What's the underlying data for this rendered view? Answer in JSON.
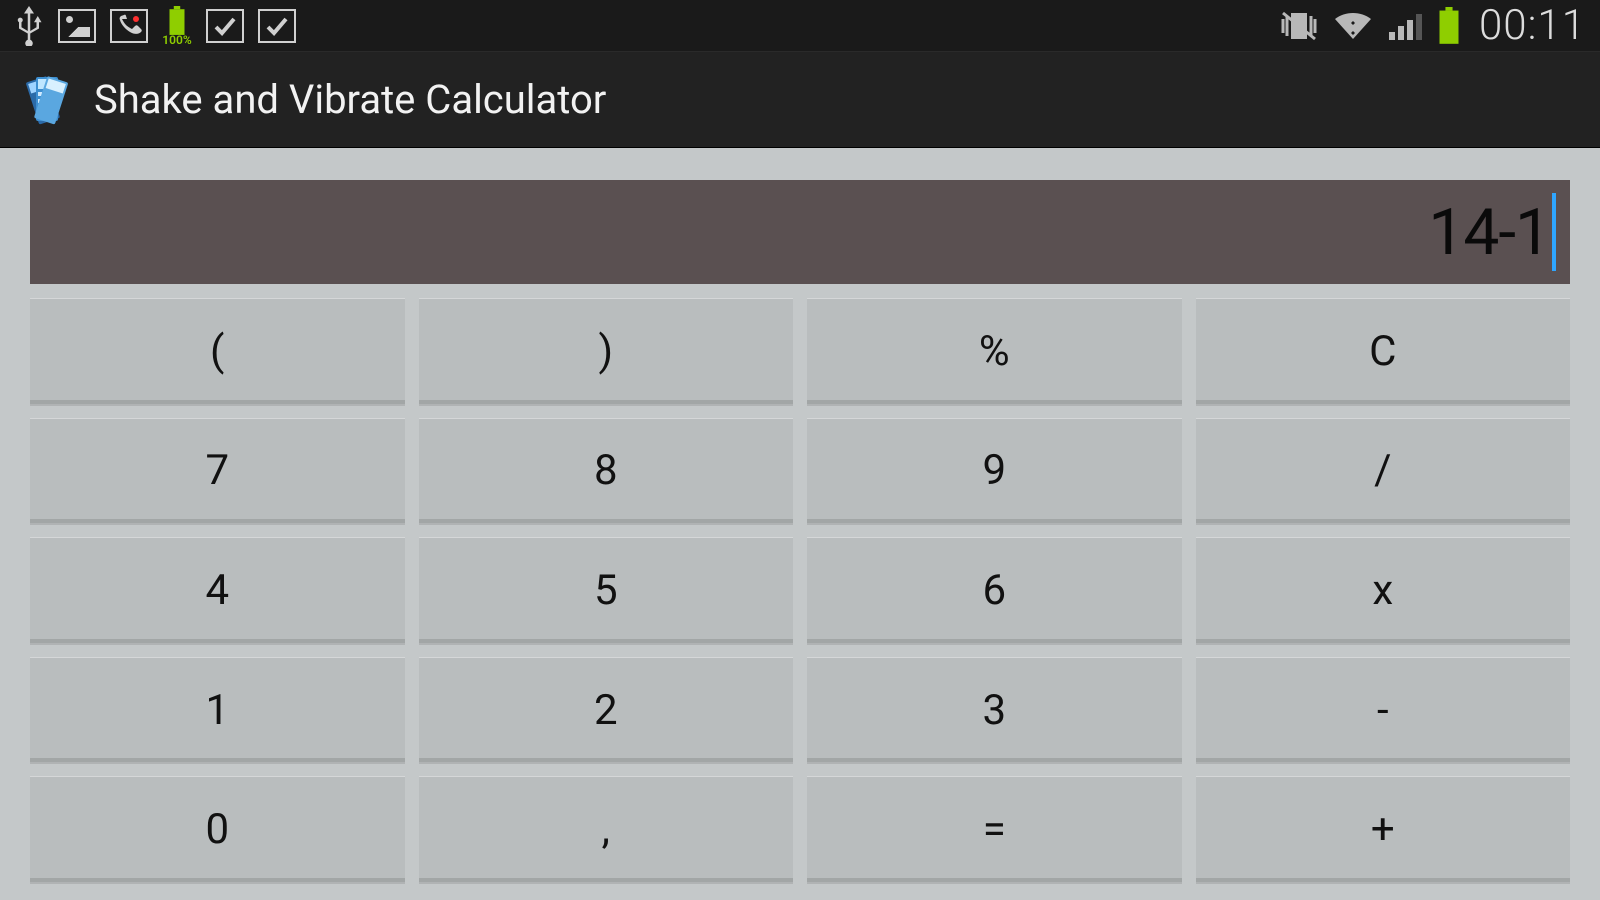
{
  "status": {
    "battery_left_text": "100%",
    "clock": "00:11"
  },
  "app": {
    "title": "Shake and Vibrate Calculator"
  },
  "display": {
    "value": "14-1"
  },
  "keys": {
    "r0c0": "(",
    "r0c1": ")",
    "r0c2": "%",
    "r0c3": "C",
    "r1c0": "7",
    "r1c1": "8",
    "r1c2": "9",
    "r1c3": "/",
    "r2c0": "4",
    "r2c1": "5",
    "r2c2": "6",
    "r2c3": "x",
    "r3c0": "1",
    "r3c1": "2",
    "r3c2": "3",
    "r3c3": "-",
    "r4c0": "0",
    "r4c1": ",",
    "r4c2": "=",
    "r4c3": "+"
  }
}
